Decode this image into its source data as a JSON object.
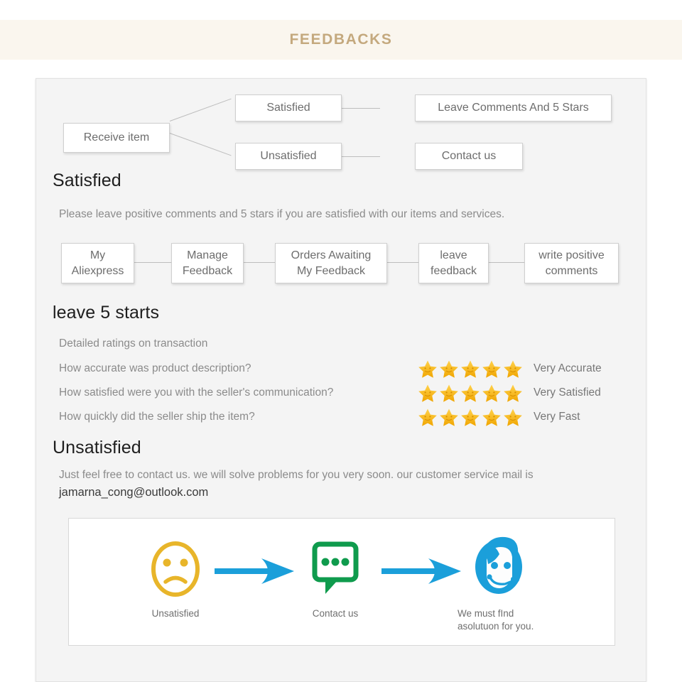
{
  "banner": {
    "title": "FEEDBACKS"
  },
  "flow": {
    "start": "Receive item",
    "branch_satisfied": "Satisfied",
    "branch_unsatisfied": "Unsatisfied",
    "result_satisfied": "Leave Comments And 5 Stars",
    "result_unsatisfied": "Contact us"
  },
  "satisfied": {
    "heading": "Satisfied",
    "description": "Please leave positive comments and 5 stars if you are satisfied with our items and services.",
    "steps": [
      {
        "line1": "My",
        "line2": "Aliexpress"
      },
      {
        "line1": "Manage",
        "line2": "Feedback"
      },
      {
        "line1": "Orders Awaiting",
        "line2": "My Feedback"
      },
      {
        "line1": "leave",
        "line2": "feedback"
      },
      {
        "line1": "write positive",
        "line2": "comments"
      }
    ]
  },
  "ratings": {
    "heading": "leave 5 starts",
    "subtitle": "Detailed ratings on transaction",
    "star_color_light": "#ffd24d",
    "star_color_dark": "#f0a500",
    "rows": [
      {
        "question": "How accurate was product description?",
        "stars": 5,
        "result": "Very Accurate"
      },
      {
        "question": "How satisfied were you with the seller's communication?",
        "stars": 5,
        "result": "Very Satisfied"
      },
      {
        "question": "How quickly did the seller ship the item?",
        "stars": 5,
        "result": "Very Fast"
      }
    ]
  },
  "unsatisfied": {
    "heading": "Unsatisfied",
    "description": "Just feel free to contact us. we will solve problems for you very soon. our customer service mail is",
    "email": "jamarna_cong@outlook.com"
  },
  "icon_panel": {
    "accent_blue": "#1b9fda",
    "accent_green": "#0f9b4d",
    "accent_gold": "#e8b52a",
    "items": [
      {
        "icon": "sad-face-icon",
        "caption": "Unsatisfied"
      },
      {
        "icon": "speech-bubble-icon",
        "caption": "Contact us"
      },
      {
        "icon": "support-agent-icon",
        "caption": "We must fInd asolutuon for you."
      }
    ]
  }
}
